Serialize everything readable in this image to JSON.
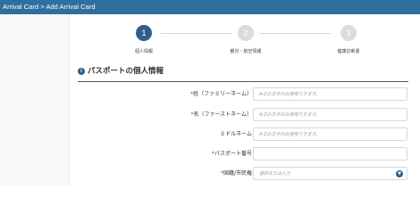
{
  "topbar": {
    "title": "Arrival Card > Add Arrival Card"
  },
  "stepper": {
    "steps": [
      {
        "number": "1",
        "label": "個人情報",
        "active": true
      },
      {
        "number": "2",
        "label": "観光・航空情報",
        "active": false
      },
      {
        "number": "3",
        "label": "健康診断書",
        "active": false
      }
    ]
  },
  "colors": {
    "topbar": "#2f6f9e",
    "accent": "#2f5f87",
    "required": "#d9253a"
  },
  "section": {
    "icon": "info-icon",
    "title": "パスポートの個人情報"
  },
  "form": {
    "fields": [
      {
        "label": "姓（ファミリーネーム）",
        "required": true,
        "placeholder": "A-Zの文字のみ使用できます。"
      },
      {
        "label": "名（ファーストネーム）",
        "required": true,
        "placeholder": "A-Zの文字のみ使用できます。"
      },
      {
        "label": "ミドルネーム",
        "required": false,
        "placeholder": "A-Zの文字のみ使用できます。"
      },
      {
        "label": "パスポート番号",
        "required": true,
        "placeholder": ""
      },
      {
        "label": "国籍/市民権",
        "required": true,
        "placeholder": "選択または入力"
      }
    ]
  }
}
